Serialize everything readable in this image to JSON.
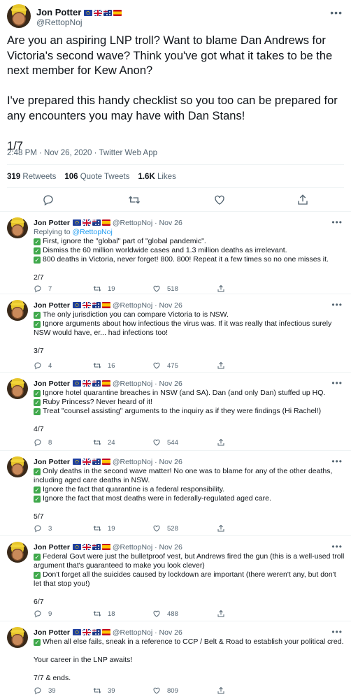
{
  "main_tweet": {
    "author_name": "Jon Potter",
    "handle": "@RettopNoj",
    "paragraphs": [
      "Are you an aspiring LNP troll? Want to blame Dan Andrews for Victoria's second wave? Think you've got what it takes to be the next member for Kew Anon?",
      "I've prepared this handy checklist so you too can be prepared for any encounters you may have with Dan Stans!",
      "1/7"
    ],
    "timestamp": "2:48 PM · Nov 26, 2020 · Twitter Web App",
    "retweets_count": "319",
    "retweets_label": "Retweets",
    "quote_count": "106",
    "quote_label": "Quote Tweets",
    "likes_count": "1.6K",
    "likes_label": "Likes"
  },
  "flags": [
    "eu-flag-icon",
    "uk-flag-icon",
    "au-flag-icon",
    "es-flag-icon"
  ],
  "replies": [
    {
      "name": "Jon Potter",
      "handle": "@RettopNoj",
      "date": "Nov 26",
      "replying_prefix": "Replying to ",
      "replying_handle": "@RettopNoj",
      "lines": [
        "First, ignore the \"global\" part of \"global pandemic\".",
        "Dismiss the 60 million worldwide cases and 1.3 million deaths as irrelevant.",
        "800 deaths in Victoria, never forget! 800. 800! Repeat it a few times so no one misses it."
      ],
      "counter": "2/7",
      "replies": "7",
      "retweets": "19",
      "likes": "518"
    },
    {
      "name": "Jon Potter",
      "handle": "@RettopNoj",
      "date": "Nov 26",
      "lines": [
        "The only jurisdiction you can compare Victoria to is NSW.",
        "Ignore arguments about how infectious the virus was. If it was really that infectious surely NSW would have, er... had infections too!"
      ],
      "counter": "3/7",
      "replies": "4",
      "retweets": "16",
      "likes": "475"
    },
    {
      "name": "Jon Potter",
      "handle": "@RettopNoj",
      "date": "Nov 26",
      "lines": [
        "Ignore hotel quarantine breaches in NSW (and SA). Dan (and only Dan) stuffed up HQ.",
        "Ruby Princess? Never heard of it!",
        "Treat \"counsel assisting\" arguments to the inquiry as if they were findings (Hi Rachel!)"
      ],
      "counter": "4/7",
      "replies": "8",
      "retweets": "24",
      "likes": "544"
    },
    {
      "name": "Jon Potter",
      "handle": "@RettopNoj",
      "date": "Nov 26",
      "lines": [
        "Only deaths in the second wave matter! No one was to blame for any of the other deaths, including aged care deaths in NSW.",
        "Ignore the fact that quarantine is a federal responsibility.",
        "Ignore the fact that most deaths were in federally-regulated aged care."
      ],
      "counter": "5/7",
      "replies": "3",
      "retweets": "19",
      "likes": "528"
    },
    {
      "name": "Jon Potter",
      "handle": "@RettopNoj",
      "date": "Nov 26",
      "lines": [
        "Federal Govt were just the bulletproof vest, but Andrews fired the gun (this is a well-used troll argument that's guaranteed to make you look clever)",
        "Don't forget all the suicides caused by lockdown are important (there weren't any, but don't let that stop you!)"
      ],
      "counter": "6/7",
      "replies": "9",
      "retweets": "18",
      "likes": "488"
    },
    {
      "name": "Jon Potter",
      "handle": "@RettopNoj",
      "date": "Nov 26",
      "lines": [
        "When all else fails, sneak in a reference to CCP / Belt & Road to establish your political cred."
      ],
      "outro": "Your career in the LNP awaits!",
      "counter": "7/7 & ends.",
      "replies": "39",
      "retweets": "39",
      "likes": "809"
    }
  ],
  "colors": {
    "text": "#0f1419",
    "muted": "#536471",
    "link": "#1d9bf0",
    "check": "#3fa84b",
    "divider": "#eff3f4"
  },
  "icons": {
    "reply": "reply-icon",
    "retweet": "retweet-icon",
    "like": "heart-icon",
    "share": "share-icon",
    "more": "more-icon",
    "check": "check-icon"
  }
}
